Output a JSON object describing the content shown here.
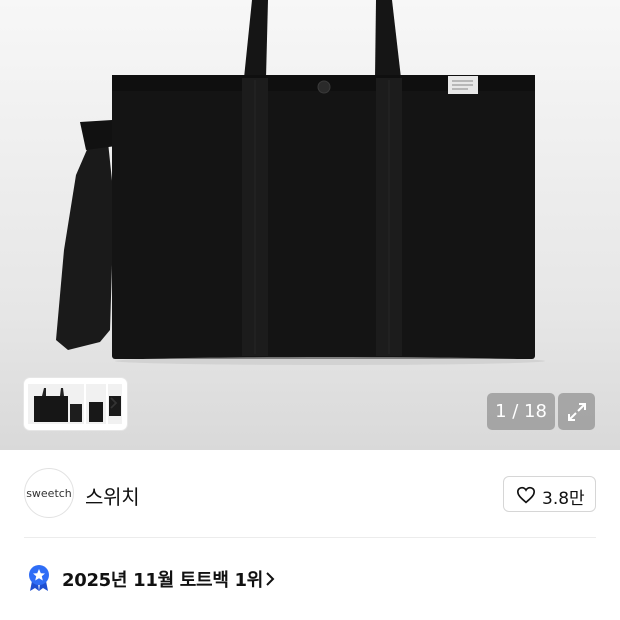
{
  "gallery": {
    "current_image": "1",
    "separator": "/",
    "total_images": "18",
    "counter_text": "1 / 18",
    "expand_icon": "expand-icon",
    "thumbnail_next_icon": "chevron-right-icon"
  },
  "brand": {
    "logo_text": "sweetch",
    "name": "스위치",
    "like_icon": "heart-outline-icon",
    "like_count": "3.8만"
  },
  "ranking": {
    "badge_icon": "star-medal-icon",
    "text": "2025년 11월 토트백 1위",
    "chevron_icon": "chevron-right-icon",
    "badge_color": "#2f6df6"
  },
  "colors": {
    "product_black": "#131313",
    "background": "#ececec"
  }
}
